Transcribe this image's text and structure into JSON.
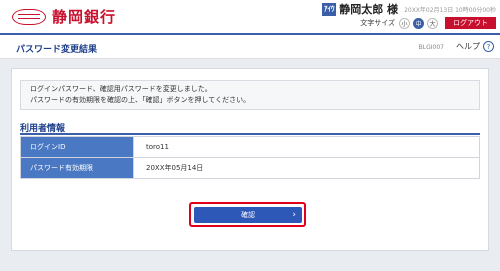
{
  "header": {
    "bank_name": "静岡銀行",
    "user_badge": "ｱｲｳ",
    "user_name": "静岡太郎 様",
    "last_login": "20XX年02月13日 10時00分00秒",
    "font_size_label": "文字サイズ",
    "font_sizes": [
      "小",
      "中",
      "大"
    ],
    "font_size_selected": "中",
    "logout_label": "ログアウト"
  },
  "title_bar": {
    "page_title": "パスワード変更結果",
    "screen_id": "BLGI007",
    "help_label": "ヘルプ",
    "help_icon": "?"
  },
  "message": {
    "line1": "ログインパスワード、確認用パスワードを変更しました。",
    "line2": "パスワードの有効期限を確認の上、「確認」ボタンを押してください。"
  },
  "user_info": {
    "section_title": "利用者情報",
    "rows": [
      {
        "label": "ログインID",
        "value": "toro11"
      },
      {
        "label": "パスワード有効期限",
        "value": "20XX年05月14日"
      }
    ]
  },
  "actions": {
    "confirm_label": "確認",
    "confirm_chevron": "›"
  },
  "colors": {
    "brand_red": "#c8102e",
    "primary_blue": "#2d58b8",
    "highlight_red": "#e0001b"
  }
}
